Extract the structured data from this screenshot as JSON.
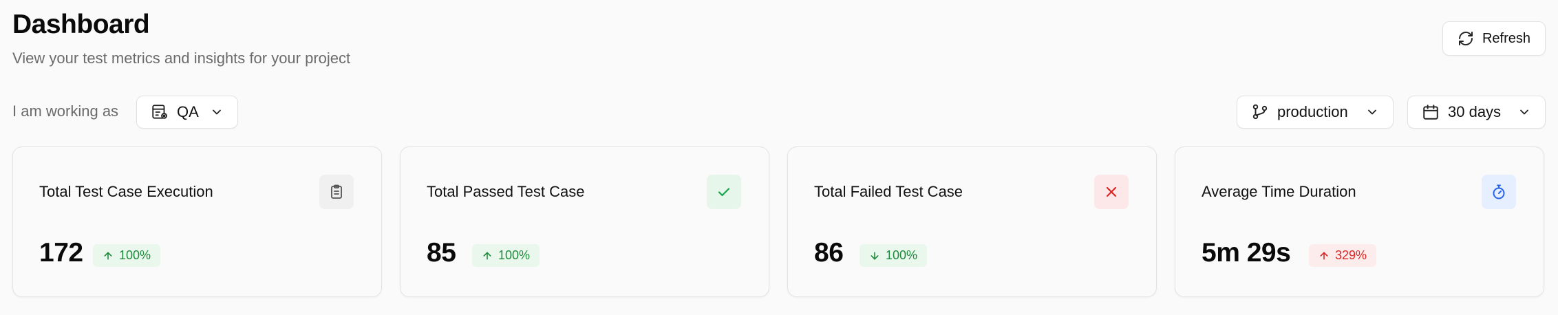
{
  "header": {
    "title": "Dashboard",
    "subtitle": "View your test metrics and insights for your project",
    "refresh_label": "Refresh"
  },
  "filters": {
    "working_as_label": "I am working as",
    "role": {
      "value": "QA",
      "icon": "role-icon"
    },
    "branch": {
      "value": "production",
      "icon": "git-branch-icon"
    },
    "range": {
      "value": "30 days",
      "icon": "calendar-icon"
    }
  },
  "cards": [
    {
      "title": "Total Test Case Execution",
      "value": "172",
      "change": "100%",
      "direction": "up",
      "tone": "green",
      "icon": "clipboard-icon",
      "icon_color": "#525252",
      "icon_bg": "#f0f0f0"
    },
    {
      "title": "Total Passed Test Case",
      "value": "85",
      "change": "100%",
      "direction": "up",
      "tone": "green",
      "icon": "check-icon",
      "icon_color": "#16a34a",
      "icon_bg": "#e6f6ea"
    },
    {
      "title": "Total Failed Test Case",
      "value": "86",
      "change": "100%",
      "direction": "down",
      "tone": "green",
      "icon": "x-icon",
      "icon_color": "#dc2626",
      "icon_bg": "#fce8e8"
    },
    {
      "title": "Average Time Duration",
      "value": "5m 29s",
      "change": "329%",
      "direction": "up",
      "tone": "red",
      "icon": "stopwatch-icon",
      "icon_color": "#2563eb",
      "icon_bg": "#e6efff"
    }
  ]
}
